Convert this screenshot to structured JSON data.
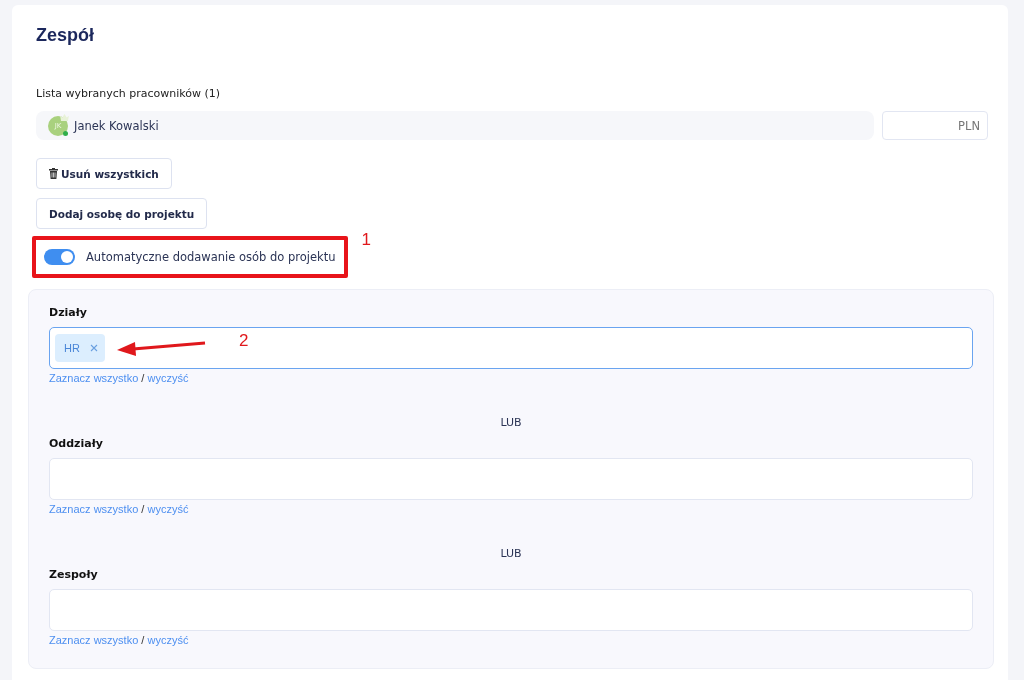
{
  "title": "Zespół",
  "selected_list": {
    "label": "Lista wybranych pracowników (1)",
    "employees": [
      {
        "name": "Janek Kowalski",
        "initials": "JK",
        "online": true,
        "currency": "PLN"
      }
    ]
  },
  "buttons": [
    {
      "kind": "trash",
      "label": "Usuń wszystkich"
    },
    {
      "kind": "plain",
      "label": "Dodaj osobę do projektu"
    }
  ],
  "auto_add": {
    "label": "Automatyczne dodawanie osób do projektu",
    "on": true,
    "annotation": "1"
  },
  "filters": [
    {
      "label": "Działy",
      "chips": [
        {
          "label": "HR",
          "annotation": "2"
        }
      ],
      "select_all": "Zaznacz wszystko",
      "separator": "/",
      "clear": "wyczyść"
    },
    {
      "or_label": "LUB",
      "label": "Oddziały",
      "select_all": "Zaznacz wszystko",
      "separator": "/",
      "clear": "wyczyść"
    },
    {
      "or_label": "LUB",
      "label": "Zespoły",
      "select_all": "Zaznacz wszystko",
      "separator": "/",
      "clear": "wyczyść"
    }
  ]
}
